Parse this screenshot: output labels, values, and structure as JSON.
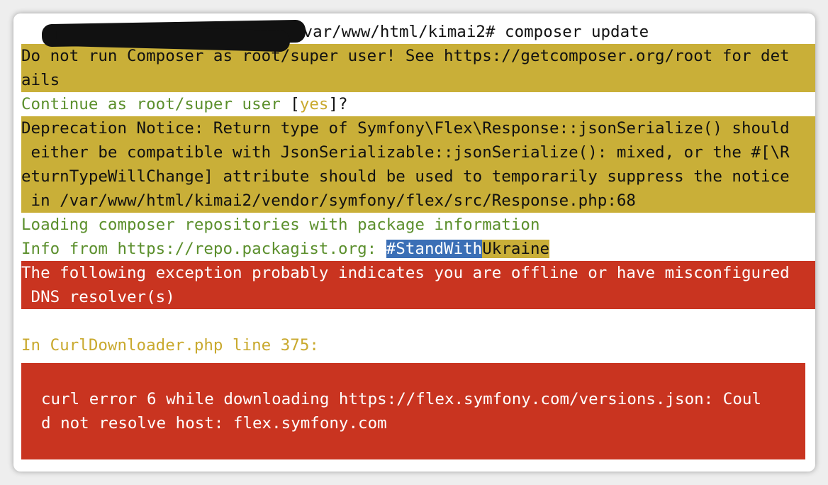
{
  "prompt": {
    "path": "/var/www/html/kimai2#",
    "command": "composer update"
  },
  "warning_root": {
    "lines": [
      "Do not run Composer as root/super user! See https://getcomposer.org/root for det",
      "ails"
    ]
  },
  "question": {
    "before": "Continue as root/super user ",
    "bracket_open": "[",
    "default": "yes",
    "after": "]?"
  },
  "deprecation": {
    "lines": [
      "Deprecation Notice: Return type of Symfony\\Flex\\Response::jsonSerialize() should",
      " either be compatible with JsonSerializable::jsonSerialize(): mixed, or the #[\\R",
      "eturnTypeWillChange] attribute should be used to temporarily suppress the notice",
      " in /var/www/html/kimai2/vendor/symfony/flex/src/Response.php:68"
    ]
  },
  "loading": "Loading composer repositories with package information",
  "info": {
    "prefix": "Info from https://repo.packagist.org: ",
    "tag_part1": "#StandWith",
    "tag_part2": "Ukraine"
  },
  "exception_notice": {
    "lines": [
      "The following exception probably indicates you are offline or have misconfigured",
      " DNS resolver(s)"
    ]
  },
  "location": "In CurlDownloader.php line 375:",
  "error_box": {
    "lines": [
      "curl error 6 while downloading https://flex.symfony.com/versions.json: Coul",
      "d not resolve host: flex.symfony.com"
    ]
  },
  "colors": {
    "warning_bg": "#c9af38",
    "error_bg": "#c93420",
    "info_text": "#5b8f2c",
    "comment_text": "#c9a92e",
    "highlight_blue": "#3b6fb6"
  }
}
